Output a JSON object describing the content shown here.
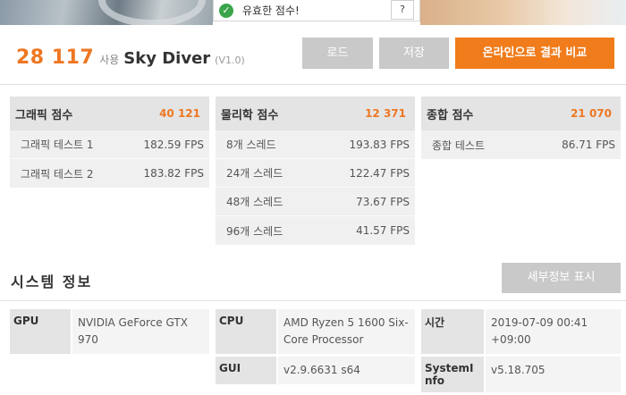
{
  "banner": {
    "valid_text": "유효한 점수!",
    "help_label": "?"
  },
  "score": {
    "total": "28 117",
    "use_word": "사용",
    "benchmark": "Sky Diver",
    "version": "(V1.0)"
  },
  "buttons": {
    "load": "로드",
    "save": "저장",
    "compare": "온라인으로 결과 비교"
  },
  "panels": {
    "graphics": {
      "title": "그래픽 점수",
      "score": "40 121",
      "rows": [
        {
          "label": "그래픽 테스트 1",
          "value": "182.59 FPS"
        },
        {
          "label": "그래픽 테스트 2",
          "value": "183.82 FPS"
        }
      ]
    },
    "physics": {
      "title": "물리학 점수",
      "score": "12 371",
      "rows": [
        {
          "label": "8개 스레드",
          "value": "193.83 FPS"
        },
        {
          "label": "24개 스레드",
          "value": "122.47 FPS"
        },
        {
          "label": "48개 스레드",
          "value": "73.67 FPS"
        },
        {
          "label": "96개 스레드",
          "value": "41.57 FPS"
        }
      ]
    },
    "combined": {
      "title": "종합 점수",
      "score": "21 070",
      "rows": [
        {
          "label": "종합 테스트",
          "value": "86.71 FPS"
        }
      ]
    }
  },
  "system": {
    "title": "시스템 정보",
    "detail_button": "세부정보 표시",
    "gpu": {
      "key": "GPU",
      "value": "NVIDIA GeForce GTX 970"
    },
    "cpu": {
      "key": "CPU",
      "value": "AMD Ryzen 5 1600 Six-Core Processor"
    },
    "gui": {
      "key": "GUI",
      "value": "v2.9.6631 s64"
    },
    "time": {
      "key": "시간",
      "value": "2019-07-09 00:41 +09:00"
    },
    "sysinfo": {
      "key": "SystemInfo",
      "value": "v5.18.705"
    }
  },
  "colors": {
    "accent": "#ee7722",
    "button_orange": "#f07c1b",
    "button_grey": "#c9c9c9",
    "valid_green": "#3aa54a"
  }
}
